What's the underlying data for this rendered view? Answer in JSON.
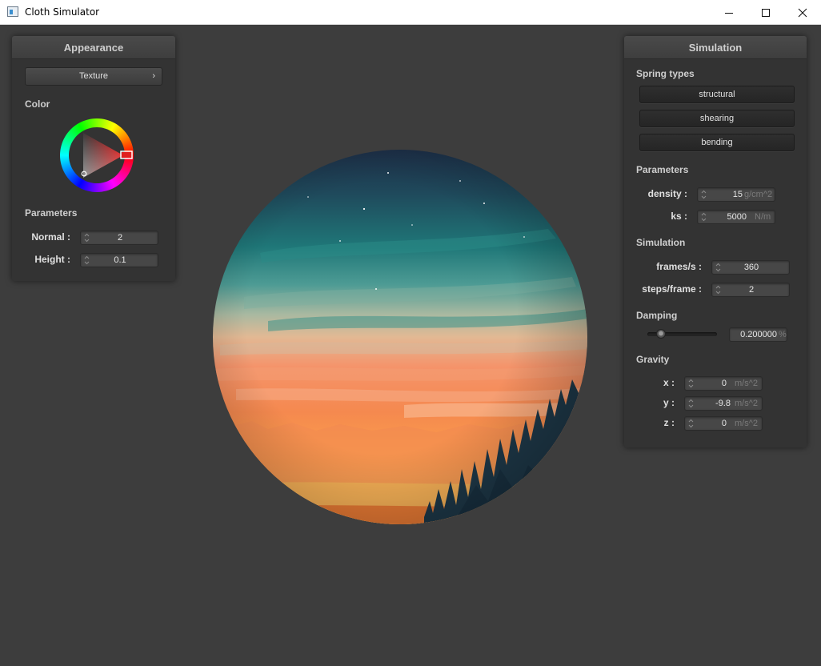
{
  "window": {
    "title": "Cloth Simulator"
  },
  "appearance": {
    "header": "Appearance",
    "texture_label": "Texture",
    "color_label": "Color",
    "params_label": "Parameters",
    "normal_label": "Normal :",
    "normal_value": "2",
    "height_label": "Height :",
    "height_value": "0.1",
    "color_accent": "#e02020"
  },
  "simulation": {
    "header": "Simulation",
    "spring_types_label": "Spring types",
    "springs": [
      "structural",
      "shearing",
      "bending"
    ],
    "params_label": "Parameters",
    "density_label": "density :",
    "density_value": "15",
    "density_unit": "g/cm^2",
    "ks_label": "ks :",
    "ks_value": "5000",
    "ks_unit": "N/m",
    "simulation_label": "Simulation",
    "fps_label": "frames/s :",
    "fps_value": "360",
    "steps_label": "steps/frame :",
    "steps_value": "2",
    "damping_label": "Damping",
    "damping_value": "0.200000",
    "damping_unit": "%",
    "damping_slider_level": 0.2,
    "gravity_label": "Gravity",
    "gx_label": "x :",
    "gx_value": "0",
    "gy_label": "y :",
    "gy_value": "-9.8",
    "gz_label": "z :",
    "gz_value": "0",
    "gravity_unit": "m/s^2"
  }
}
